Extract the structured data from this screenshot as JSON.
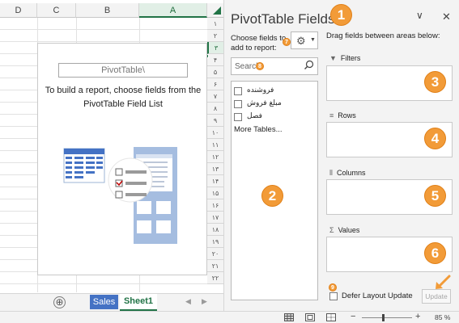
{
  "sheet": {
    "columns": [
      "D",
      "C",
      "B",
      "A"
    ],
    "selected_column": "A",
    "rows": [
      "١",
      "٢",
      "٣",
      "۴",
      "۵",
      "۶",
      "٧",
      "٨",
      "٩",
      "١٠",
      "١١",
      "١٢",
      "١٣",
      "١۴",
      "١۵",
      "١۶",
      "١٧",
      "١٨",
      "١٩",
      "٢٠",
      "٢١",
      "٢٢"
    ],
    "pivot_name": "PivotTable\\",
    "pivot_instruction": "To build a report, choose fields from the PivotTable Field List"
  },
  "tabs": {
    "new_sheet": "⊕",
    "items": [
      "Sales",
      "Sheet1"
    ],
    "active": "Sheet1",
    "scroll_left": "◀",
    "scroll_right": "▶"
  },
  "pane": {
    "title": "PivotTable Fields",
    "collapse_glyph": "∨",
    "close_glyph": "✕",
    "choose_label": "Choose fields to add to report:",
    "drag_label": "Drag fields between areas below:",
    "search_placeholder": "Search",
    "search_icon": "search-icon",
    "fields": [
      "فروشنده",
      "مبلغ فروش",
      "فصل"
    ],
    "more_tables": "More Tables...",
    "areas": [
      {
        "label": "Filters",
        "icon": "filter-icon"
      },
      {
        "label": "Rows",
        "icon": "rows-icon"
      },
      {
        "label": "Columns",
        "icon": "columns-icon"
      },
      {
        "label": "Values",
        "icon": "sigma-icon"
      }
    ],
    "defer_label": "Defer Layout Update",
    "update_label": "Update"
  },
  "callouts": {
    "big": [
      "1",
      "2",
      "3",
      "4",
      "5",
      "6"
    ],
    "small": [
      "7",
      "8",
      "9"
    ]
  },
  "status": {
    "zoom_minus": "−",
    "zoom_plus": "+",
    "zoom_level": "85 %",
    "zoom_value_percent": 85
  },
  "colors": {
    "excel_green": "#217346",
    "callout_orange": "#f29b38",
    "sales_tab_blue": "#4472c4"
  }
}
